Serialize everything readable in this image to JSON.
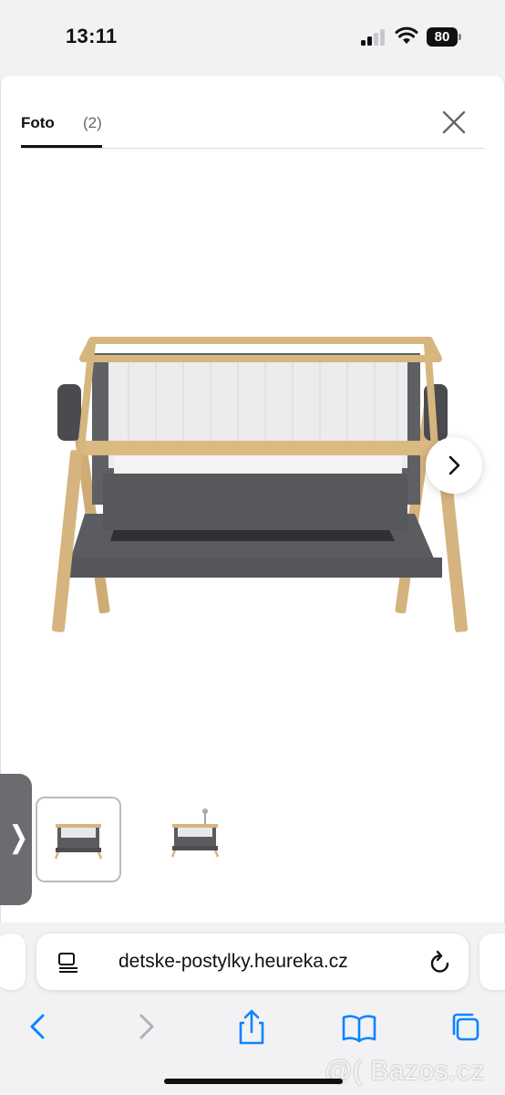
{
  "status_bar": {
    "time": "13:11",
    "battery": "80"
  },
  "gallery": {
    "tab_label": "Foto",
    "tab_count": "(2)",
    "side_tab_glyph": "❭"
  },
  "browser": {
    "url": "detske-postylky.heureka.cz"
  },
  "watermark": "@( Bazos.cz",
  "colors": {
    "accent": "#0a84ff",
    "frame_wood": "#d9b77f",
    "fabric_gray": "#5a5b5f"
  }
}
